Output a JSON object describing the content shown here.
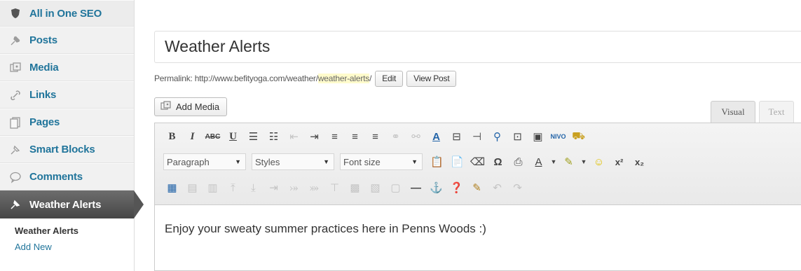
{
  "sidebar": {
    "items": [
      {
        "label": "All in One SEO",
        "icon": "shield-icon"
      },
      {
        "label": "Posts",
        "icon": "pin-icon"
      },
      {
        "label": "Media",
        "icon": "media-icon"
      },
      {
        "label": "Links",
        "icon": "link-icon"
      },
      {
        "label": "Pages",
        "icon": "pages-icon"
      },
      {
        "label": "Smart Blocks",
        "icon": "pin-icon"
      },
      {
        "label": "Comments",
        "icon": "comment-icon"
      },
      {
        "label": "Weather Alerts",
        "icon": "pin-icon"
      }
    ],
    "submenu": {
      "current": "Weather Alerts",
      "add_new": "Add New"
    }
  },
  "post": {
    "title": "Weather Alerts",
    "permalink_label": "Permalink:",
    "permalink_base": "http://www.befityoga.com/weather/",
    "permalink_slug": "weather-alerts",
    "permalink_trailing": "/",
    "edit_label": "Edit",
    "view_post_label": "View Post"
  },
  "media": {
    "add_media_label": "Add Media"
  },
  "editor": {
    "tabs": {
      "visual": "Visual",
      "text": "Text"
    },
    "format_select": "Paragraph",
    "styles_select": "Styles",
    "fontsize_select": "Font size",
    "content": "Enjoy your sweaty summer practices here in Penns Woods :)"
  },
  "colors": {
    "link": "#21759b",
    "active_menu": "#555555",
    "slug_highlight": "#fffbcc"
  }
}
